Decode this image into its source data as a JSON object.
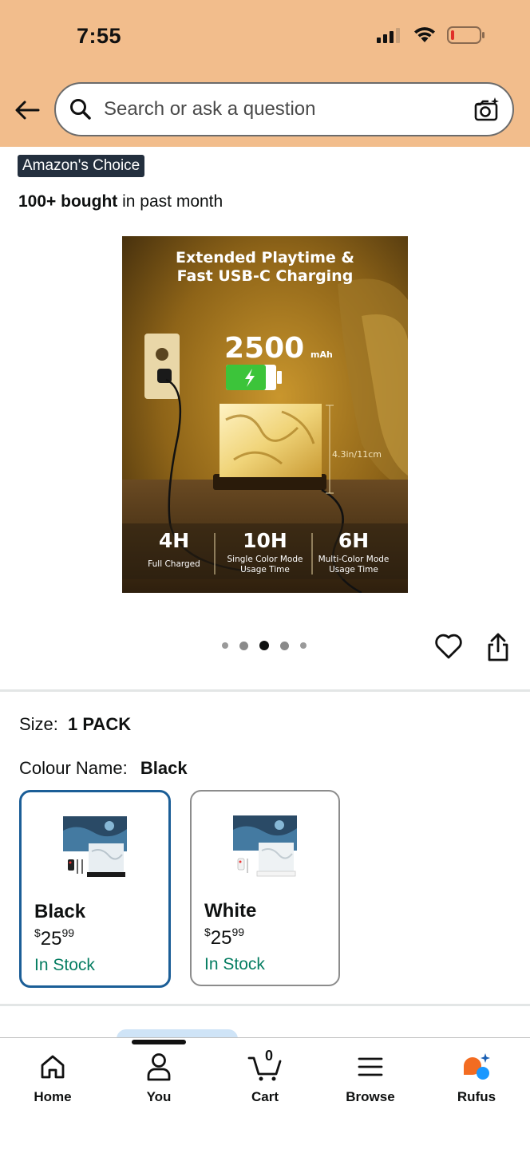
{
  "status_bar": {
    "time": "7:55"
  },
  "search": {
    "placeholder": "Search or ask a question"
  },
  "product": {
    "badge": "Amazon's Choice",
    "bought_bold": "100+ bought",
    "bought_rest": " in past month",
    "image": {
      "headline_line1": "Extended Playtime &",
      "headline_line2": "Fast USB-C Charging",
      "capacity": "2500",
      "capacity_unit": "mAh",
      "dimension": "4.3in/11cm",
      "stats": [
        {
          "value": "4H",
          "label_line1": "Full Charged",
          "label_line2": ""
        },
        {
          "value": "10H",
          "label_line1": "Single Color Mode",
          "label_line2": "Usage Time"
        },
        {
          "value": "6H",
          "label_line1": "Multi-Color Mode",
          "label_line2": "Usage Time"
        }
      ]
    },
    "carousel": {
      "count": 5,
      "active_index": 2
    }
  },
  "options": {
    "size_label": "Size:",
    "size_value": "1 PACK",
    "colour_label": "Colour Name:",
    "colour_value": "Black",
    "swatches": [
      {
        "name": "Black",
        "currency": "$",
        "price_whole": "25",
        "price_fraction": "99",
        "stock": "In Stock",
        "selected": true
      },
      {
        "name": "White",
        "currency": "$",
        "price_whole": "25",
        "price_fraction": "99",
        "stock": "In Stock",
        "selected": false
      }
    ]
  },
  "bottom_nav": {
    "items": [
      {
        "label": "Home",
        "icon": "home-icon"
      },
      {
        "label": "You",
        "icon": "person-icon"
      },
      {
        "label": "Cart",
        "icon": "cart-icon",
        "count": "0"
      },
      {
        "label": "Browse",
        "icon": "menu-icon"
      },
      {
        "label": "Rufus",
        "icon": "rufus-icon"
      }
    ]
  },
  "colors": {
    "header_bg": "#f2bd8c",
    "badge_bg": "#232f3e",
    "stock_green": "#067d62",
    "selected_border": "#1b5e97"
  }
}
